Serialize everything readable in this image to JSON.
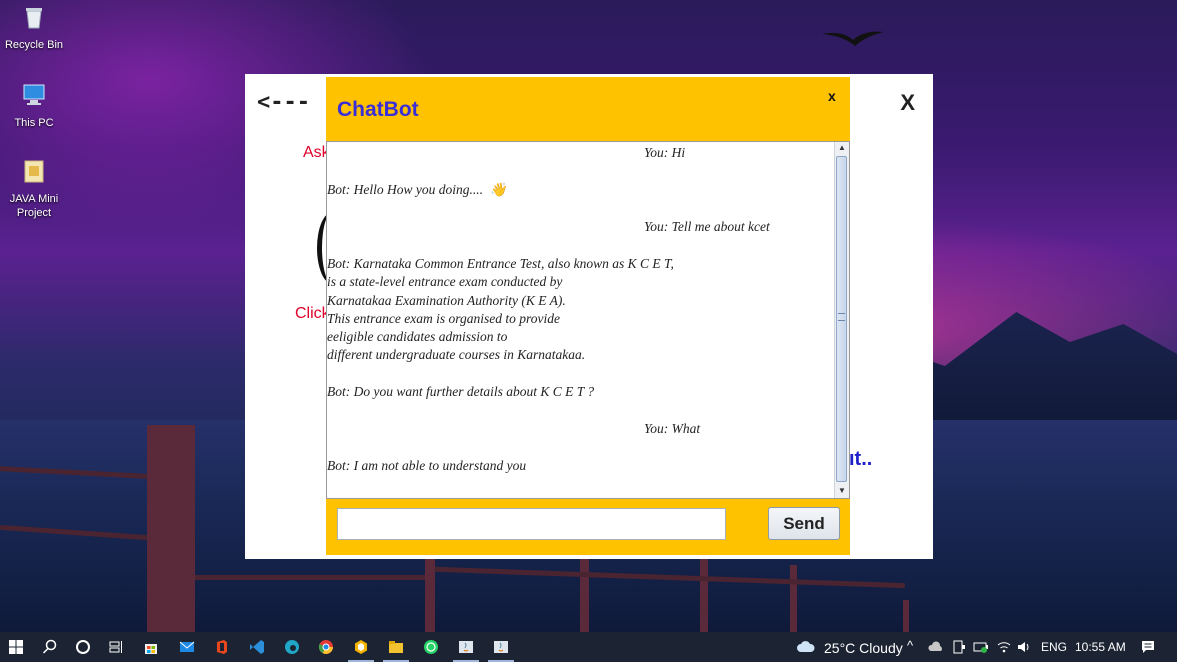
{
  "desktop": {
    "icons": [
      {
        "label": "Recycle Bin"
      },
      {
        "label": "This PC"
      },
      {
        "label": "JAVA Mini\nProject"
      }
    ]
  },
  "app": {
    "back_label": "<---",
    "close_label": "X",
    "ask_fragment": "Ask",
    "click_fragment": "Click",
    "bot_fragment": "ıt.."
  },
  "chatbot": {
    "title": "ChatBot",
    "close_label": "x",
    "messages": [
      {
        "sender": "user",
        "text": "You: Hi"
      },
      {
        "sender": "bot",
        "text": "Bot: Hello How you doing....  👋"
      },
      {
        "sender": "user",
        "text": "You: Tell me about kcet"
      },
      {
        "sender": "bot",
        "text": "Bot: Karnataka Common Entrance Test, also known as K C E T,\nis a state-level entrance exam conducted by\nKarnatakaa Examination Authority (K E A).\nThis entrance exam is organised to provide\neeligible candidates admission to\ndifferent undergraduate courses in Karnatakaa."
      },
      {
        "sender": "bot",
        "text": "Bot: Do you want further details about K C E T ?"
      },
      {
        "sender": "user",
        "text": "You: What"
      },
      {
        "sender": "bot",
        "text": "Bot: I am not able to understand you"
      }
    ],
    "input_value": "",
    "send_label": "Send"
  },
  "taskbar": {
    "weather": "25°C  Cloudy",
    "language": "ENG",
    "time": "10:55 AM"
  },
  "colors": {
    "chat_frame": "#ffc200",
    "chat_title": "#3a2fd6",
    "red_label": "#e0002a"
  }
}
